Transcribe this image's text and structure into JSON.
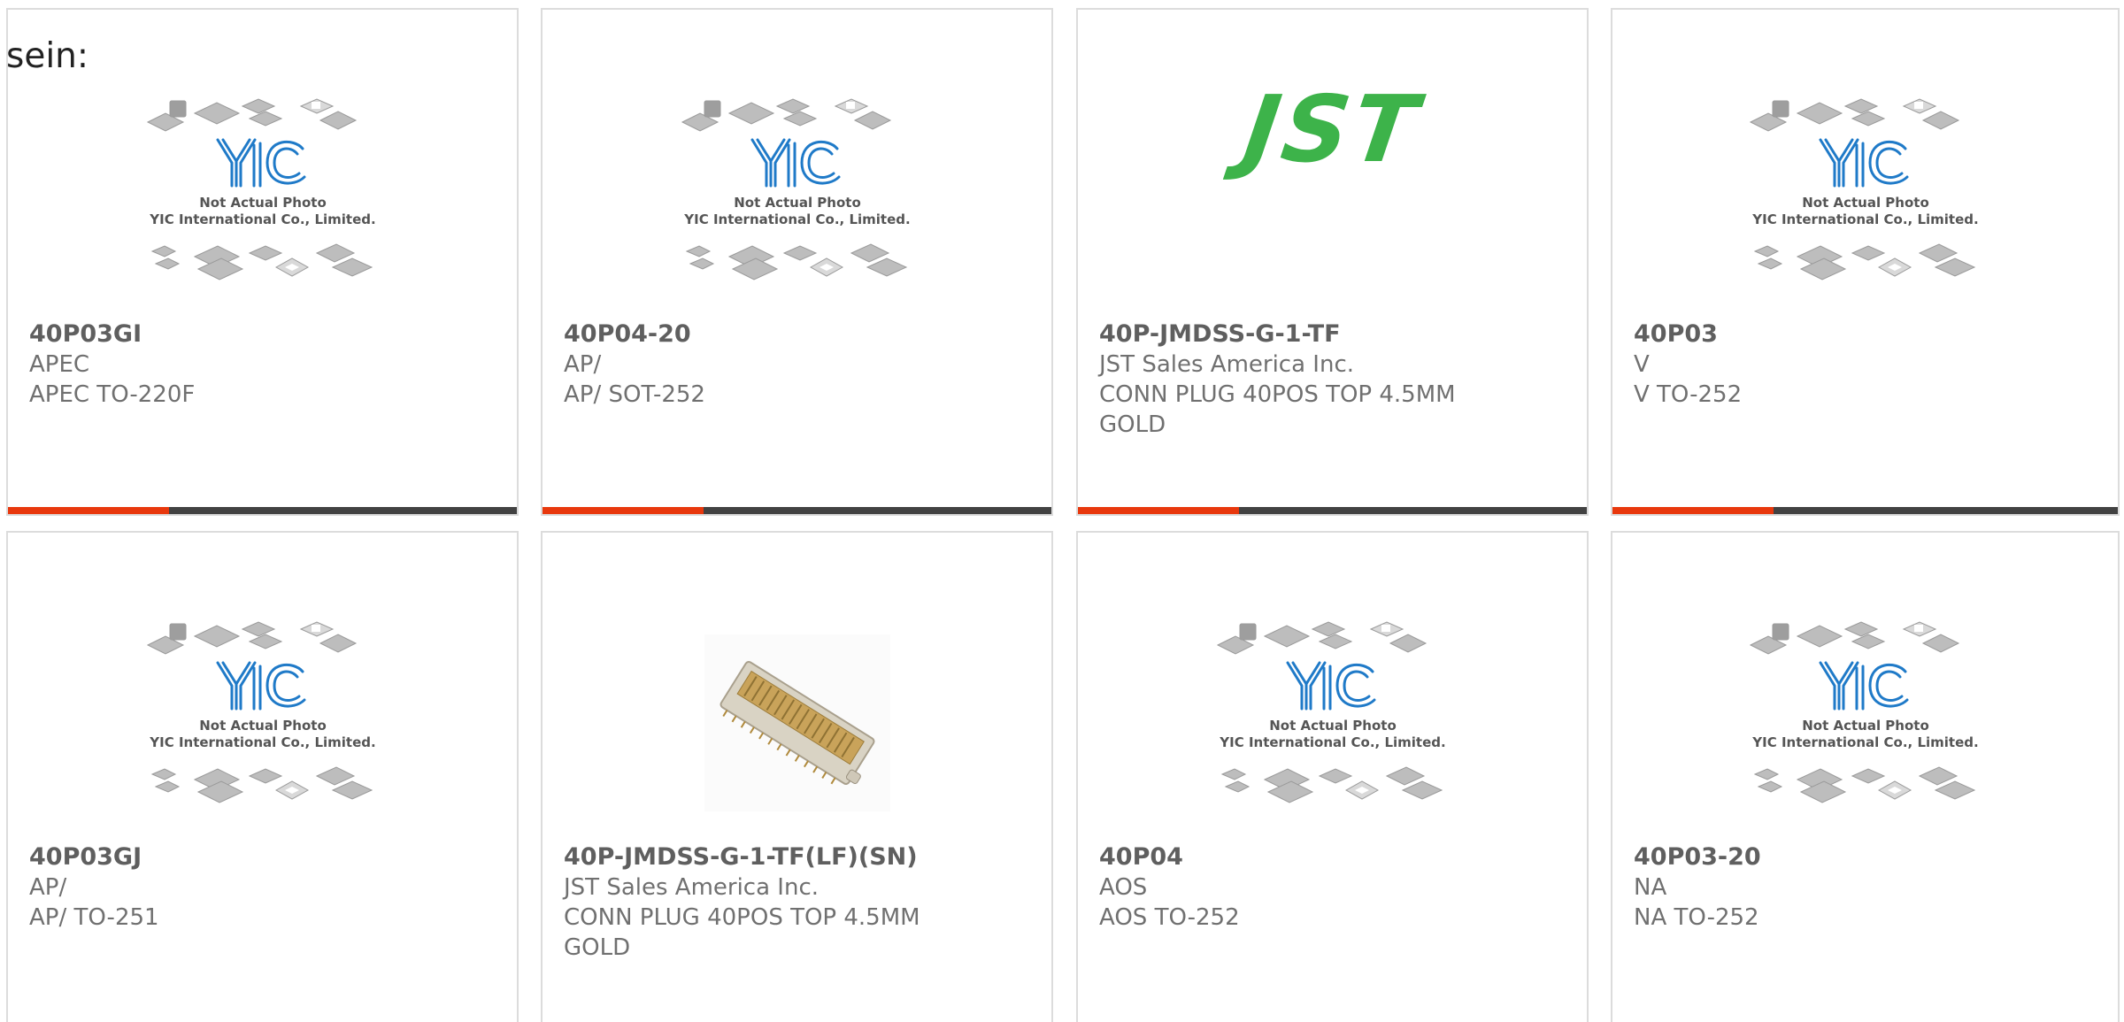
{
  "intro_text": "sein:",
  "placeholder_caption": {
    "line1": "Not Actual Photo",
    "line2": "YIC International Co., Limited.",
    "logo": "YIC"
  },
  "jst_logo_text": "JST",
  "colors": {
    "accent": "#e8380d",
    "bar": "#424242",
    "jst_green": "#3db34a",
    "yic_blue": "#1f7ac8"
  },
  "products": [
    {
      "part": "40P03GI",
      "brand": "APEC",
      "desc": "APEC TO-220F",
      "image": "yic-placeholder"
    },
    {
      "part": "40P04-20",
      "brand": "AP/",
      "desc": "AP/ SOT-252",
      "image": "yic-placeholder"
    },
    {
      "part": "40P-JMDSS-G-1-TF",
      "brand": "JST Sales America Inc.",
      "desc": "CONN PLUG 40POS TOP 4.5MM GOLD",
      "image": "jst-logo"
    },
    {
      "part": "40P03",
      "brand": "V",
      "desc": "V TO-252",
      "image": "yic-placeholder"
    },
    {
      "part": "40P03GJ",
      "brand": "AP/",
      "desc": "AP/ TO-251",
      "image": "yic-placeholder"
    },
    {
      "part": "40P-JMDSS-G-1-TF(LF)(SN)",
      "brand": "JST Sales America Inc.",
      "desc": "CONN PLUG 40POS TOP 4.5MM GOLD",
      "image": "connector-photo"
    },
    {
      "part": "40P04",
      "brand": "AOS",
      "desc": "AOS TO-252",
      "image": "yic-placeholder"
    },
    {
      "part": "40P03-20",
      "brand": "NA",
      "desc": "NA TO-252",
      "image": "yic-placeholder"
    }
  ]
}
